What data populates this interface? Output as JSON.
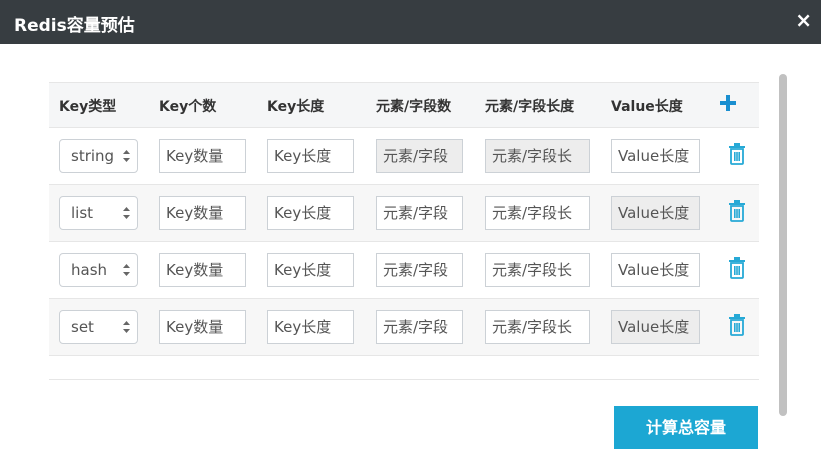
{
  "dialog": {
    "title": "Redis容量预估",
    "close_glyph": "×"
  },
  "table": {
    "headers": [
      "Key类型",
      "Key个数",
      "Key长度",
      "元素/字段数",
      "元素/字段长度",
      "Value长度"
    ],
    "rows": [
      {
        "type": "string",
        "key_count": "Key数量",
        "key_length": "Key长度",
        "elem_count": "元素/字段",
        "elem_length": "元素/字段长",
        "value_length": "Value长度"
      },
      {
        "type": "list",
        "key_count": "Key数量",
        "key_length": "Key长度",
        "elem_count": "元素/字段",
        "elem_length": "元素/字段长",
        "value_length": "Value长度"
      },
      {
        "type": "hash",
        "key_count": "Key数量",
        "key_length": "Key长度",
        "elem_count": "元素/字段",
        "elem_length": "元素/字段长",
        "value_length": "Value长度"
      },
      {
        "type": "set",
        "key_count": "Key数量",
        "key_length": "Key长度",
        "elem_count": "元素/字段",
        "elem_length": "元素/字段长",
        "value_length": "Value长度"
      }
    ]
  },
  "actions": {
    "calculate_label": "计算总容量"
  },
  "colors": {
    "titlebar": "#373d41",
    "accent": "#1ca7d3",
    "add_icon": "#1a8fd0",
    "trash_icon": "#26a9d6"
  }
}
